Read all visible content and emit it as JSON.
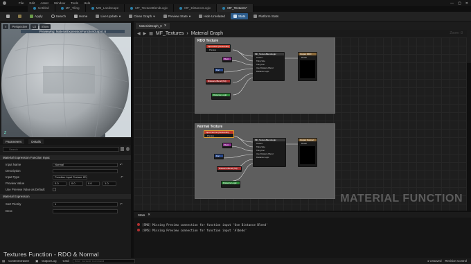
{
  "app": {
    "menu": [
      "File",
      "Edit",
      "Asset",
      "Window",
      "Tools",
      "Help"
    ],
    "doc_tabs": [
      {
        "label": "Untitled",
        "active": false
      },
      {
        "label": "MF_Tiling",
        "active": false
      },
      {
        "label": "MM_Landscape",
        "active": false
      },
      {
        "label": "MF_TextureBlendLogic",
        "active": false
      },
      {
        "label": "MF_DistanceLogic",
        "active": false
      },
      {
        "label": "MF_Textures*",
        "active": true
      }
    ]
  },
  "toolbar": {
    "save": "Save",
    "browse": "",
    "apply": "Apply",
    "search": "Search",
    "home": "Home",
    "live_update": "Live Update",
    "clean_graph": "Clean Graph",
    "preview_state": "Preview State",
    "hide_unrelated": "Hide Unrelated",
    "stats": "Stats",
    "platform_stats": "Platform Stats"
  },
  "viewport": {
    "buttons": [
      "Perspective",
      "Lit",
      "Show"
    ],
    "label": "Previewing: MaterialExpressionFunctionOutput_6"
  },
  "details": {
    "tabs": [
      "Parameters",
      "Details"
    ],
    "search_placeholder": "Search",
    "sections": {
      "function_input": "Material Expression Function Input",
      "material_expression": "Material Expression"
    },
    "props": {
      "input_name_label": "Input Name",
      "input_name_value": "Normal",
      "description_label": "Description",
      "input_type_label": "Input Type",
      "input_type_value": "Function Input Texture 2D",
      "preview_value_label": "Preview Value",
      "preview_values": [
        "0.0",
        "0.0",
        "0.0",
        "1.0"
      ],
      "use_preview_label": "Use Preview Value as Default",
      "sort_priority_label": "Sort Priority",
      "sort_priority_value": "1",
      "desc_label": "Desc"
    }
  },
  "caption": "Textures Function - RDO & Normal",
  "graph": {
    "tab": "MaterialGraph_0",
    "breadcrumb_root": "MF_Textures",
    "breadcrumb_child": "Material Graph",
    "zoom": "Zoom -3",
    "comments": [
      {
        "title": "RDO Texture",
        "nodes": {
          "input": "Input RDO (Texture2D)",
          "preview": "Preview",
          "func": "MF_TextureBlendLogic",
          "pins": [
            "Texture",
            "Tiling Size",
            "Tiling Fac",
            "Use Distance Blend",
            "Distance Logic"
          ],
          "out": "Output RDO",
          "result": "Result",
          "n1": "Bool",
          "n2": "Fac",
          "n3": "Distance Blend (S4)",
          "n4": "Distance Logic"
        }
      },
      {
        "title": "Normal Texture",
        "nodes": {
          "input": "Input Normal (Texture2D)",
          "preview": "Preview",
          "func": "MF_TextureBlendLogic",
          "pins": [
            "Texture",
            "Tiling Size",
            "Tiling Fac",
            "Use Distance Blend",
            "Distance Logic"
          ],
          "out": "Output Normal",
          "result": "Result",
          "n1": "Bool",
          "n2": "Fac",
          "n3": "Distance Blend (S4)",
          "n4": "Distance Logic"
        }
      }
    ],
    "watermark": "MATERIAL FUNCTION"
  },
  "stats": {
    "title": "Stats",
    "messages": [
      "[SM6] Missing Preview connection for function input 'Use Distance Blend'",
      "[SM5] Missing Preview connection for function input 'Albedo'"
    ]
  },
  "statusbar": {
    "content_drawer": "Content Drawer",
    "output_log": "Output Log",
    "cmd": "Cmd",
    "cmd_placeholder": "Enter Console Command",
    "unsaved": "1 Unsaved",
    "revision": "Revision Control"
  },
  "colors": {
    "accent": "#2c5c8c",
    "input_node": "#c0392b",
    "func_node": "#3a3a3a",
    "bool_node": "#8c2d8c",
    "fac_node": "#2a4a8c",
    "dist_node": "#a83030",
    "logic_node": "#2e8c3a",
    "out_node": "#8c6a3a"
  }
}
